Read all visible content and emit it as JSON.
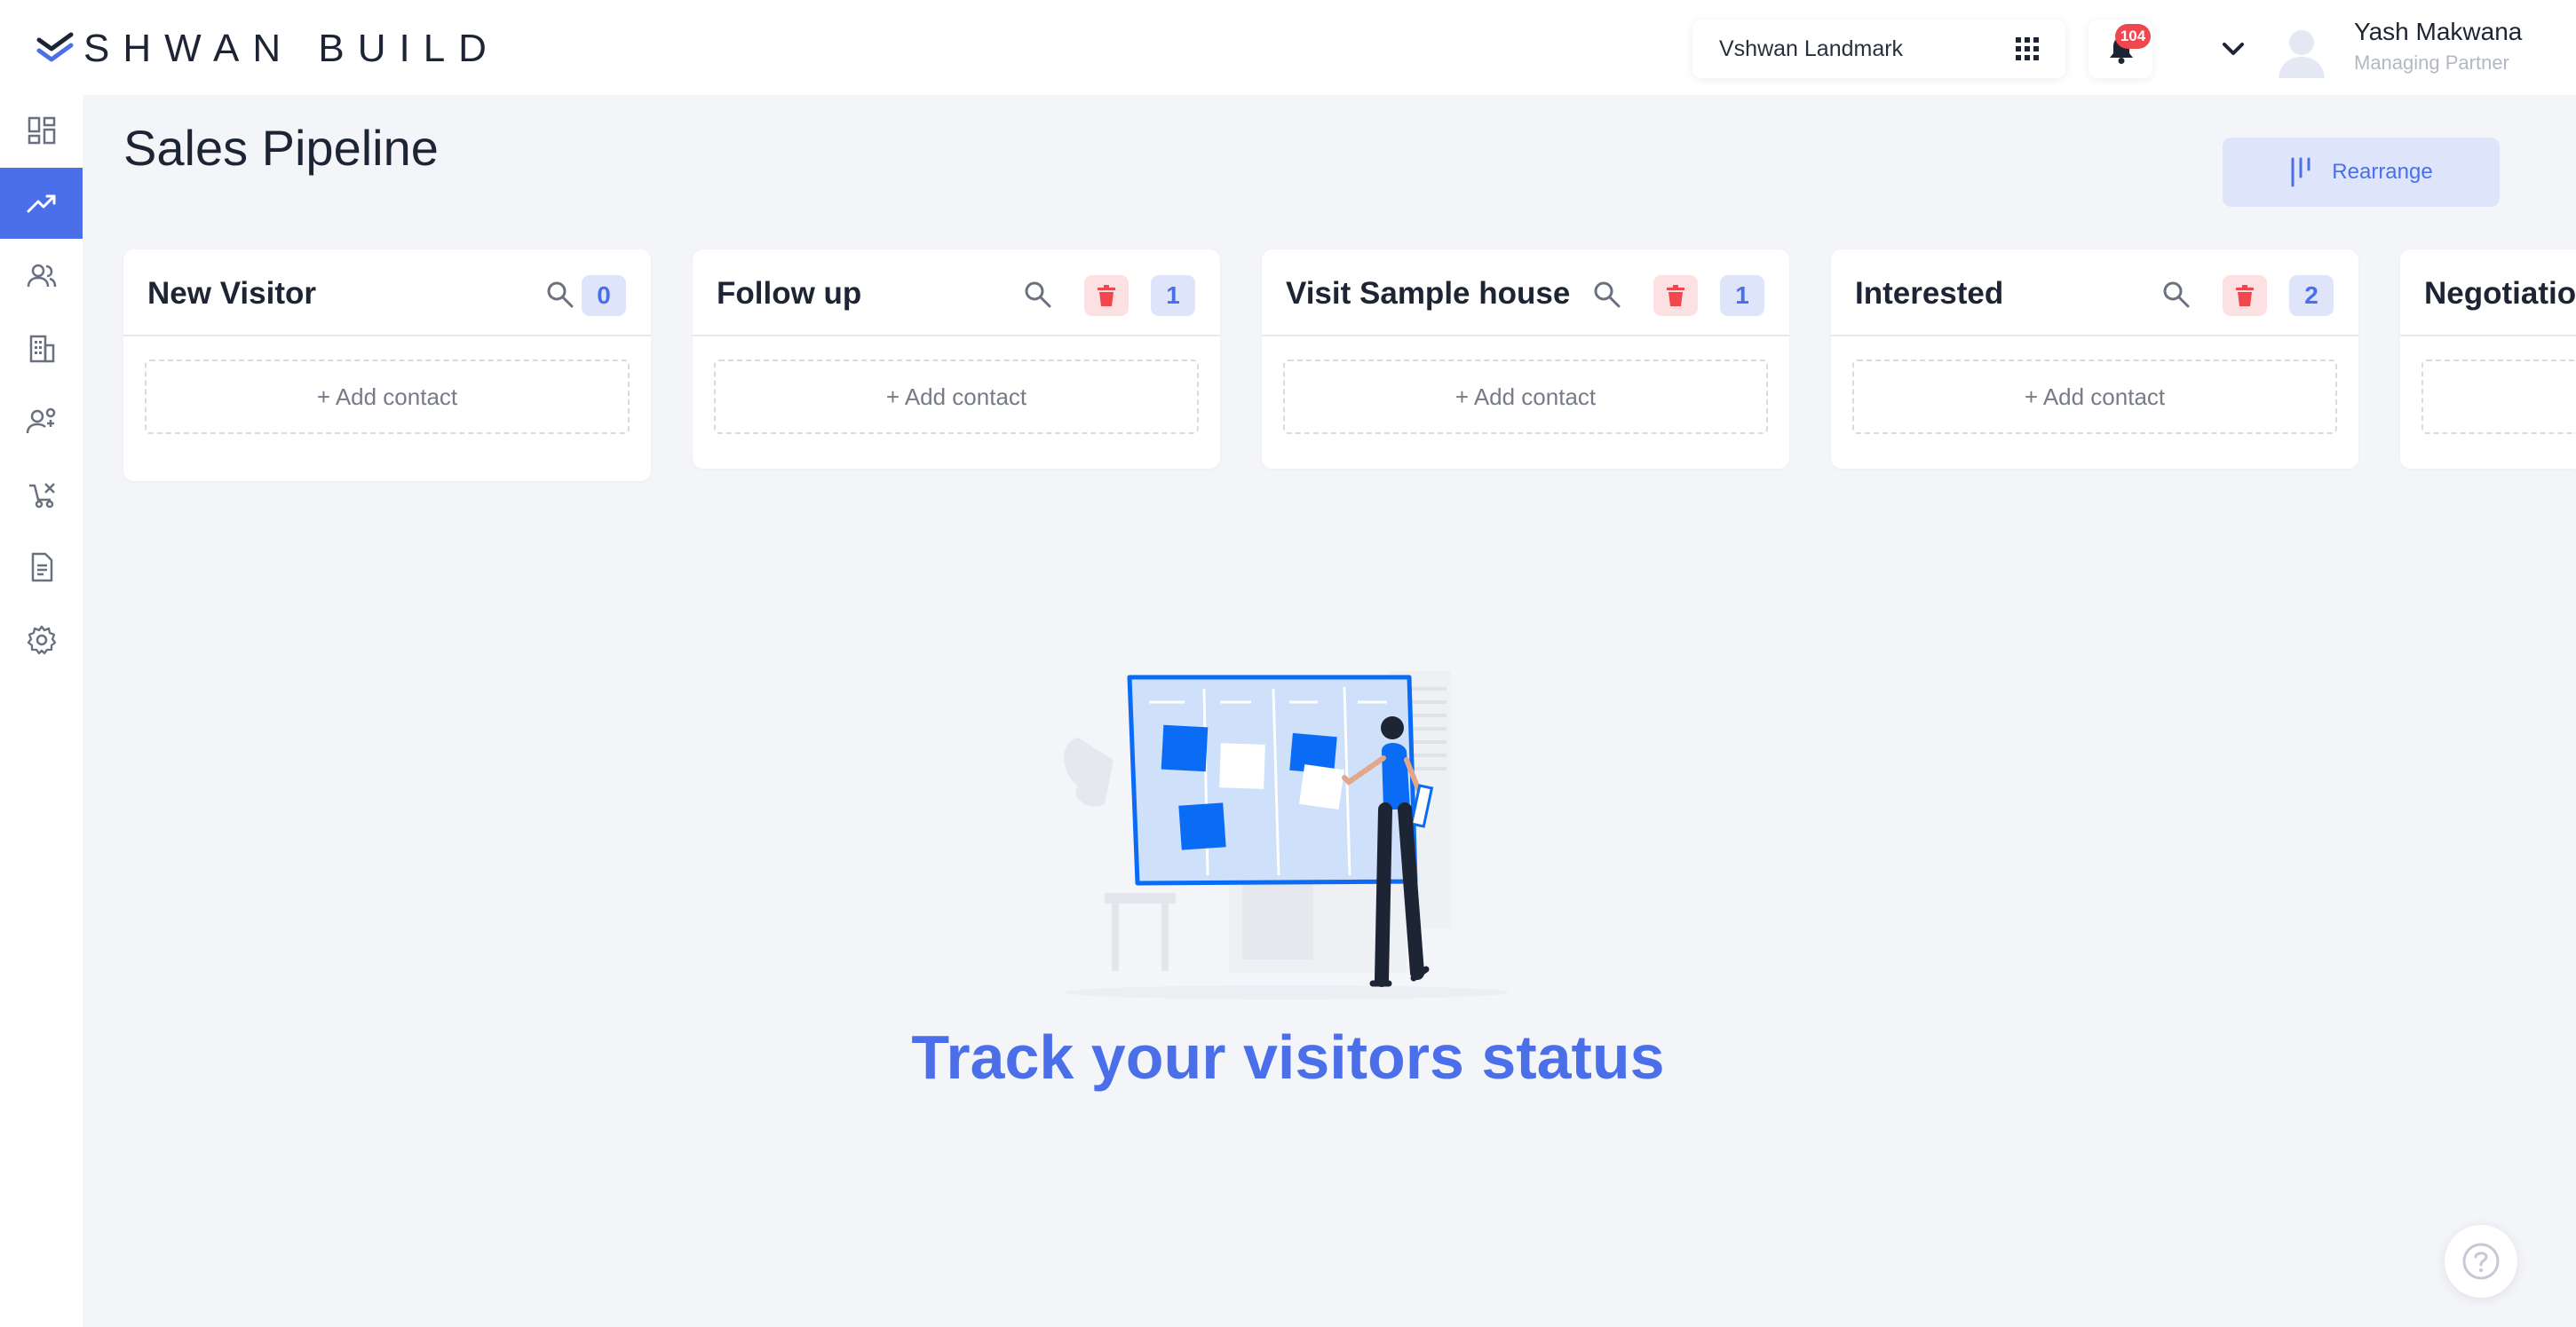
{
  "header": {
    "logo_text": "SHWAN BUILD",
    "project_name": "Vshwan Landmark",
    "notification_count": "104",
    "user_name": "Yash Makwana",
    "user_role": "Managing Partner"
  },
  "sidebar": {
    "items": [
      {
        "icon": "dashboard-icon",
        "active": false
      },
      {
        "icon": "trending-up-icon",
        "active": true
      },
      {
        "icon": "users-icon",
        "active": false
      },
      {
        "icon": "building-icon",
        "active": false
      },
      {
        "icon": "user-settings-icon",
        "active": false
      },
      {
        "icon": "broker-icon",
        "active": false
      },
      {
        "icon": "document-icon",
        "active": false
      },
      {
        "icon": "gear-icon",
        "active": false
      }
    ]
  },
  "page": {
    "title": "Sales Pipeline",
    "rearrange_label": "Rearrange"
  },
  "columns": [
    {
      "title": "New Visitor",
      "count": "0",
      "deletable": false,
      "add_label": "+ Add contact"
    },
    {
      "title": "Follow up",
      "count": "1",
      "deletable": true,
      "add_label": "+ Add contact"
    },
    {
      "title": "Visit Sample house",
      "count": "1",
      "deletable": true,
      "add_label": "+ Add contact"
    },
    {
      "title": "Interested",
      "count": "2",
      "deletable": true,
      "add_label": "+ Add contact"
    },
    {
      "title": "Negotiatio",
      "count": "",
      "deletable": false,
      "add_label": ""
    }
  ],
  "empty_state": {
    "message": "Track your visitors status"
  },
  "colors": {
    "accent": "#4b6fe9",
    "danger": "#f0464e",
    "background": "#f4f5f9"
  }
}
